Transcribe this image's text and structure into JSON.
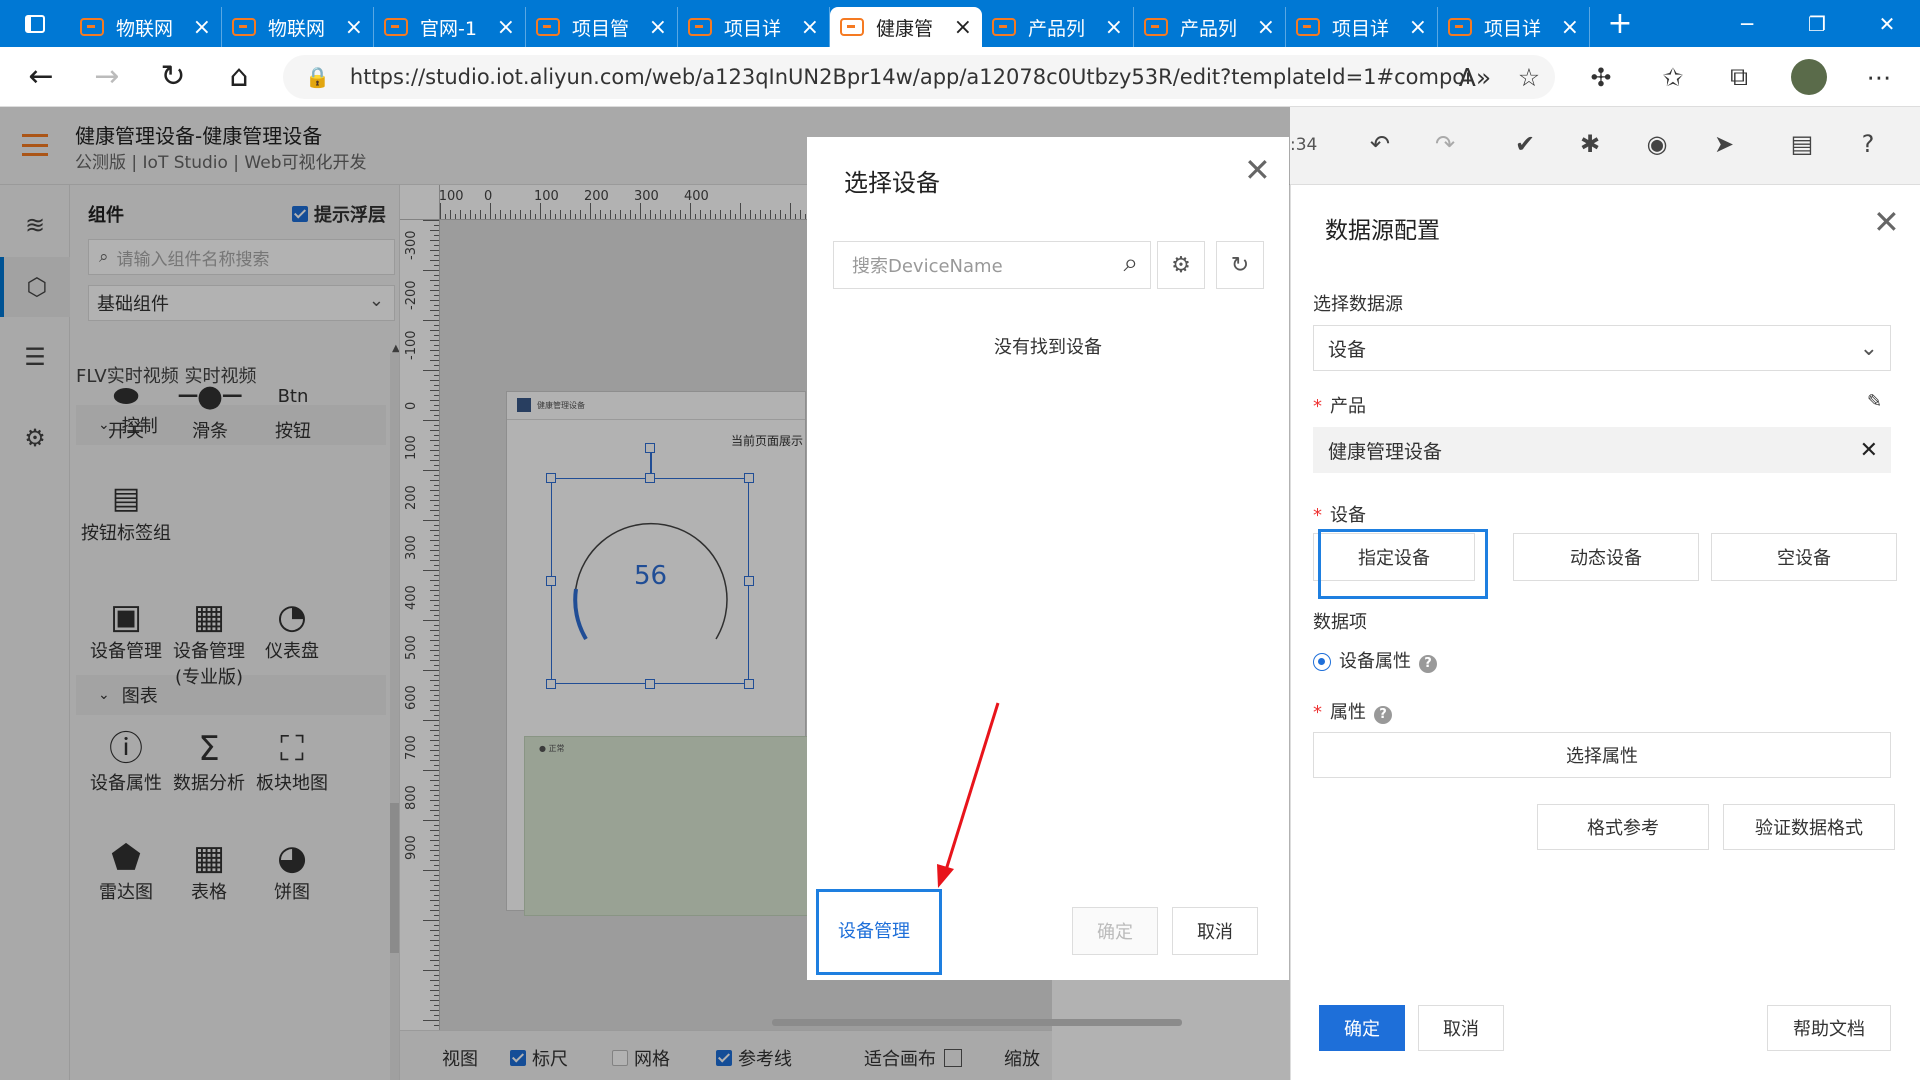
{
  "browser": {
    "tabs": [
      {
        "title": "物联网",
        "active": false
      },
      {
        "title": "物联网",
        "active": false
      },
      {
        "title": "官网-1",
        "active": false
      },
      {
        "title": "项目管",
        "active": false
      },
      {
        "title": "项目详",
        "active": false
      },
      {
        "title": "健康管",
        "active": true
      },
      {
        "title": "产品列",
        "active": false
      },
      {
        "title": "产品列",
        "active": false
      },
      {
        "title": "项目详",
        "active": false
      },
      {
        "title": "项目详",
        "active": false
      }
    ],
    "new_tab": "+",
    "url": "https://studio.iot.aliyun.com/web/a123qInUN2Bpr14w/app/a12078c0Utbzy53R/edit?templateId=1#component"
  },
  "app": {
    "title": "健康管理设备-健康管理设备",
    "subtitle": "公测版 | IoT Studio | Web可视化开发",
    "time_fragment": ":34"
  },
  "components": {
    "heading": "组件",
    "float_layer": "提示浮层",
    "search_placeholder": "请输入组件名称搜索",
    "category": "基础组件",
    "video_row": "FLV实时视频   实时视频",
    "groups": {
      "control": "控制",
      "chart": "图表"
    },
    "control_items": [
      {
        "label": "开关",
        "icon": "toggle-icon"
      },
      {
        "label": "滑条",
        "icon": "slider-icon"
      },
      {
        "label": "按钮",
        "icon": "button-icon",
        "glyph": "Btn"
      },
      {
        "label": "按钮标签组",
        "icon": "button-tag-group-icon"
      }
    ],
    "chart_items": [
      {
        "label": "设备管理",
        "icon": "device-manage-icon"
      },
      {
        "label": "设备管理 (专业版)",
        "icon": "device-manage-pro-icon"
      },
      {
        "label": "仪表盘",
        "icon": "dashboard-icon"
      },
      {
        "label": "设备属性",
        "icon": "device-property-icon"
      },
      {
        "label": "数据分析",
        "icon": "data-analysis-icon"
      },
      {
        "label": "板块地图",
        "icon": "block-map-icon"
      },
      {
        "label": "雷达图",
        "icon": "radar-icon"
      },
      {
        "label": "表格",
        "icon": "table-icon"
      },
      {
        "label": "饼图",
        "icon": "pie-icon"
      }
    ]
  },
  "canvas": {
    "ruler_top": [
      "-100",
      "0",
      "100",
      "200",
      "300",
      "400"
    ],
    "ruler_left": [
      "-300",
      "-200",
      "-100",
      "0",
      "100",
      "200",
      "300",
      "400",
      "500",
      "600",
      "700",
      "800",
      "900"
    ],
    "page_note": "当前页面展示",
    "gauge_value": "56",
    "bottom": {
      "view": "视图",
      "ruler": "标尺",
      "grid": "网格",
      "guide": "参考线",
      "fit": "适合画布",
      "zoom": "缩放"
    }
  },
  "modal": {
    "title": "选择设备",
    "search_placeholder": "搜索DeviceName",
    "empty": "没有找到设备",
    "device_manage": "设备管理",
    "ok": "确定",
    "cancel": "取消"
  },
  "datasource": {
    "title": "数据源配置",
    "select_label": "选择数据源",
    "select_value": "设备",
    "product_label": "产品",
    "product_value": "健康管理设备",
    "device_label": "设备",
    "device_buttons": [
      "指定设备",
      "动态设备",
      "空设备"
    ],
    "data_item_label": "数据项",
    "data_item_option": "设备属性",
    "property_label": "属性",
    "select_property": "选择属性",
    "format_ref": "格式参考",
    "validate": "验证数据格式",
    "ok": "确定",
    "cancel": "取消",
    "help": "帮助文档"
  },
  "colors": {
    "browser_blue": "#0078d4",
    "accent_orange": "#f57a22",
    "primary_blue": "#1e6fd9",
    "highlight_blue": "#1e7fe0",
    "annotation_red": "#e8141b"
  }
}
